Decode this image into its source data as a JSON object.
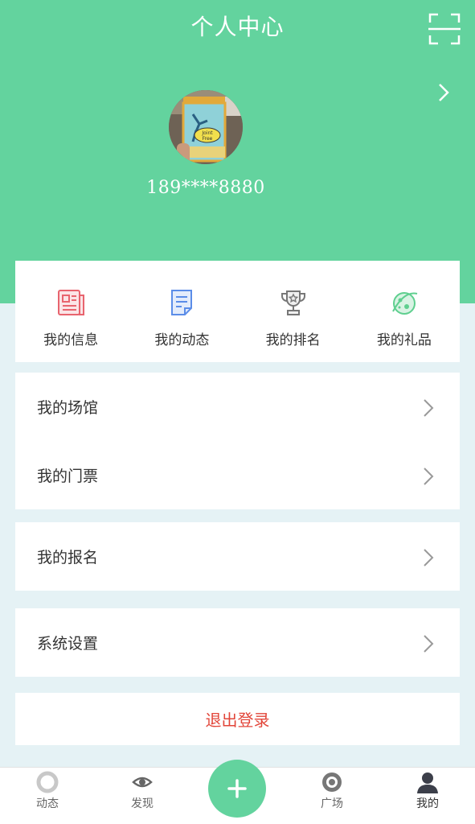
{
  "header": {
    "title": "个人中心",
    "scan_icon": "scan-icon",
    "chevron_icon": "chevron-right-icon",
    "phone": "189****8880"
  },
  "avatar": {
    "picture_text": "Joint Free"
  },
  "quick_actions": [
    {
      "label": "我的信息",
      "icon": "newspaper-icon",
      "color": "#e8646e"
    },
    {
      "label": "我的动态",
      "icon": "document-icon",
      "color": "#5b8de8"
    },
    {
      "label": "我的排名",
      "icon": "trophy-icon",
      "color": "#777777"
    },
    {
      "label": "我的礼品",
      "icon": "planet-icon",
      "color": "#5fcf8f"
    }
  ],
  "menu": {
    "venue": "我的场馆",
    "tickets": "我的门票",
    "signup": "我的报名",
    "settings": "系统设置"
  },
  "logout": "退出登录",
  "tabbar": {
    "tabs": [
      {
        "label": "动态",
        "icon": "ring-icon"
      },
      {
        "label": "发现",
        "icon": "eye-icon"
      },
      {
        "label": "广场",
        "icon": "target-icon"
      },
      {
        "label": "我的",
        "icon": "user-icon"
      }
    ],
    "center_icon": "plus-icon"
  },
  "colors": {
    "primary": "#63d39e",
    "background": "#e5f2f5",
    "logout": "#e2463a"
  }
}
